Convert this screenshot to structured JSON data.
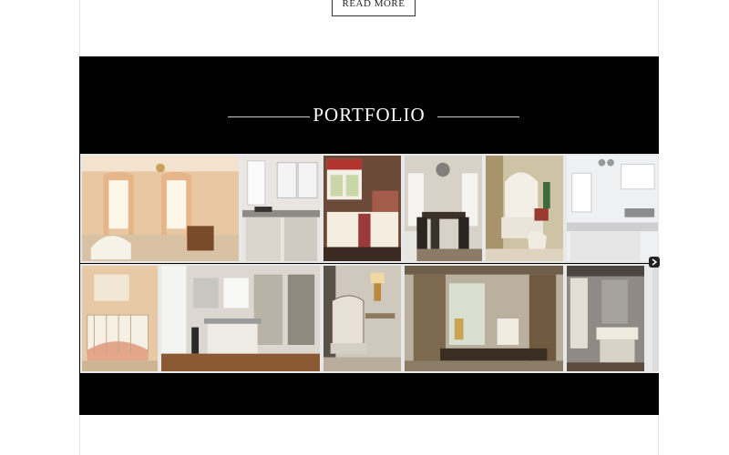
{
  "read_more": {
    "label": "READ MORE"
  },
  "portfolio": {
    "title": "PORTFOLIO",
    "row1": [
      {
        "name": "portfolio-nursery-peach"
      },
      {
        "name": "portfolio-white-kitchen"
      },
      {
        "name": "portfolio-bedroom-red-blinds"
      },
      {
        "name": "portfolio-dining-room"
      },
      {
        "name": "portfolio-white-armchair"
      },
      {
        "name": "portfolio-bright-kitchen"
      }
    ],
    "row2": [
      {
        "name": "portfolio-nursery-crib"
      },
      {
        "name": "portfolio-open-kitchen"
      },
      {
        "name": "portfolio-lounge-chair"
      },
      {
        "name": "portfolio-drapes-living-room"
      },
      {
        "name": "portfolio-bathroom"
      },
      {
        "name": "portfolio-partial-tile"
      }
    ]
  }
}
